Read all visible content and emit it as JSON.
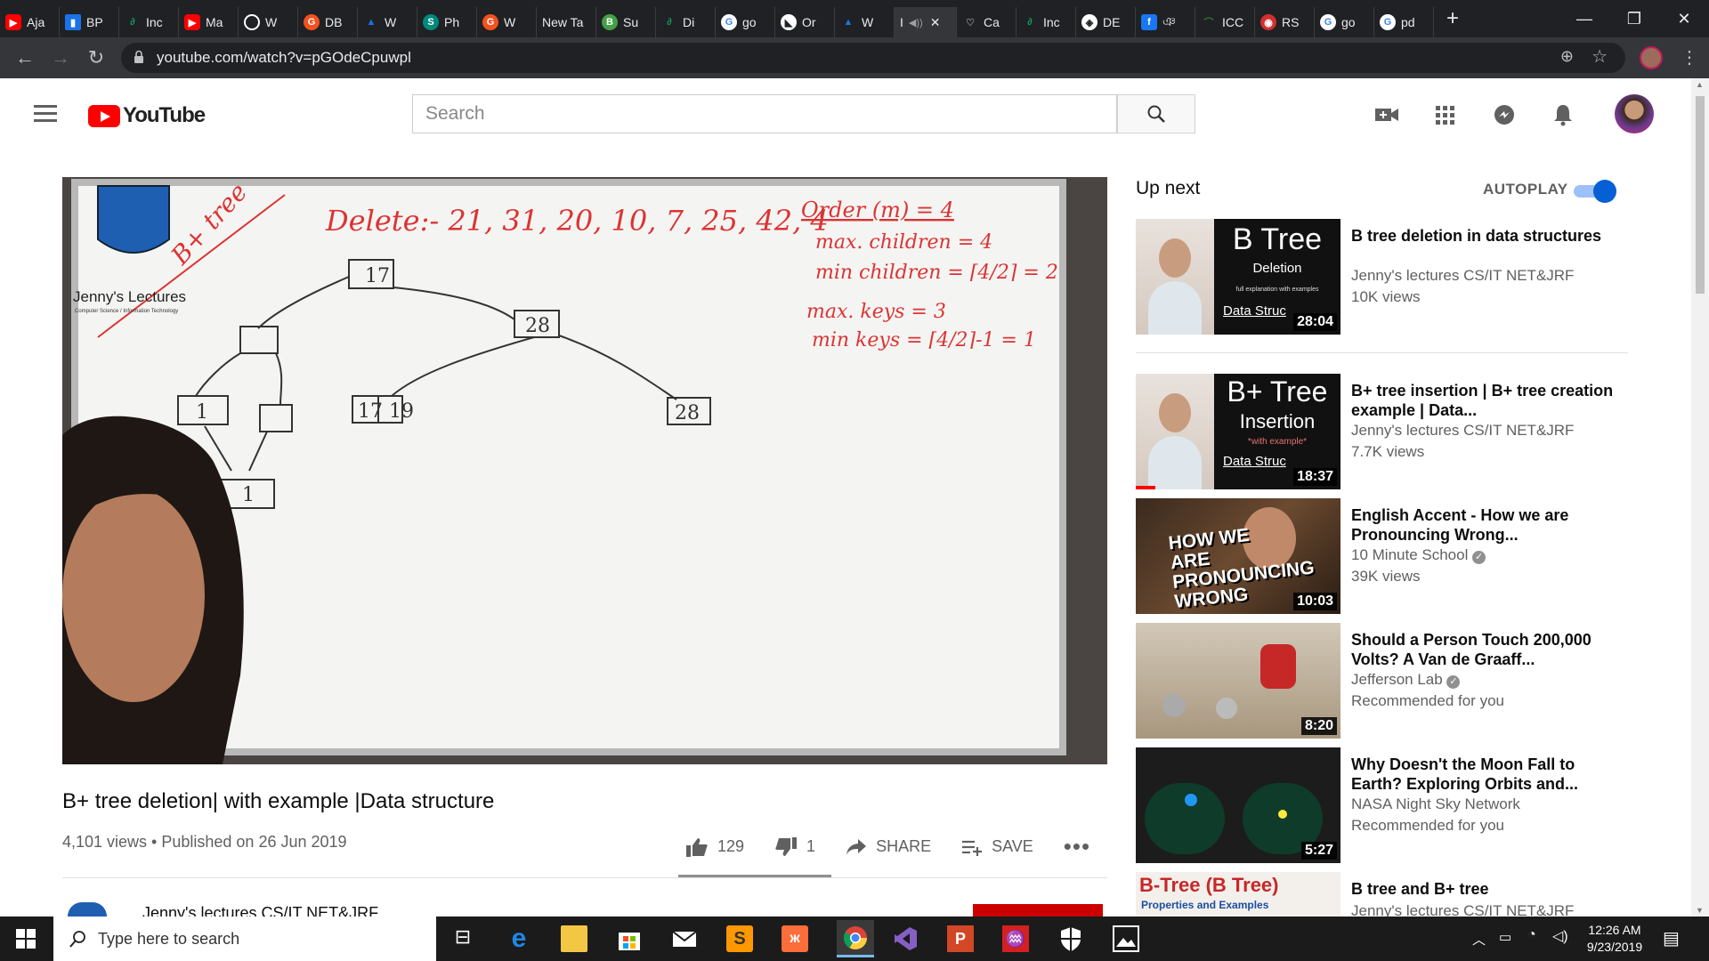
{
  "browser": {
    "tabs": [
      {
        "label": "Aja",
        "color": "#ff0000"
      },
      {
        "label": "BP",
        "color": "#1a73e8"
      },
      {
        "label": "Inc",
        "color": "#0f9d58"
      },
      {
        "label": "Ma",
        "color": "#ff0000"
      },
      {
        "label": "W",
        "color": "#ffffff"
      },
      {
        "label": "DB",
        "color": "#f4511e"
      },
      {
        "label": "W",
        "color": "#1a73e8"
      },
      {
        "label": "Ph",
        "color": "#00897b"
      },
      {
        "label": "W",
        "color": "#f4511e"
      },
      {
        "label": "New Ta",
        "color": ""
      },
      {
        "label": "Su",
        "color": "#43a047"
      },
      {
        "label": "Di",
        "color": "#0f9d58"
      },
      {
        "label": "go",
        "color": "#4285f4"
      },
      {
        "label": "Or",
        "color": "#ffffff"
      },
      {
        "label": "W",
        "color": "#1a73e8"
      },
      {
        "label": "I",
        "color": "",
        "active": true
      },
      {
        "label": "Ca",
        "color": "#888888"
      },
      {
        "label": "Inc",
        "color": "#0f9d58"
      },
      {
        "label": "DE",
        "color": "#ffffff"
      },
      {
        "label": "ঞ",
        "color": "#1877f2"
      },
      {
        "label": "ICC",
        "color": "#2e7d32"
      },
      {
        "label": "RS",
        "color": "#d32f2f"
      },
      {
        "label": "go",
        "color": "#4285f4"
      },
      {
        "label": "pd",
        "color": "#4285f4"
      }
    ],
    "url": "youtube.com/watch?v=pGOdeCpuwpl"
  },
  "youtube": {
    "logo_text": "YouTube",
    "search_placeholder": "Search"
  },
  "video": {
    "title": "B+ tree deletion| with example |Data structure",
    "meta": "4,101 views • Published on 26 Jun 2019",
    "likes": "129",
    "dislikes": "1",
    "share_label": "SHARE",
    "save_label": "SAVE",
    "channel_name": "Jenny's lectures CS/IT NET&JRF",
    "board": {
      "brand": "Jenny's Lectures",
      "brand_sub": "Computer Science / Information Technology",
      "corner_text": "B+ tree",
      "delete_line": "Delete:- 21, 31, 20, 10, 7, 25, 42, 4",
      "order": "Order (m) = 4",
      "max_children": "max. children = 4",
      "min_children": "min children = ⌈4/2⌉ = 2",
      "max_keys": "max. keys = 3",
      "min_keys": "min keys = ⌈4/2⌉-1 = 1",
      "node_root": "17",
      "node_right": "28",
      "node_mid": "17 19",
      "node_leaf_right": "28",
      "node_leaf_left": "1",
      "node_bottom": "1"
    }
  },
  "upnext": {
    "label": "Up next",
    "autoplay_label": "AUTOPLAY",
    "autoplay_on": true,
    "items": [
      {
        "title": "B tree deletion in data structures",
        "channel": "Jenny's lectures CS/IT NET&JRF",
        "views": "10K views",
        "duration": "28:04",
        "thumb_title": "B Tree",
        "thumb_sub": "Deletion",
        "thumb_small": "full explanation with examples",
        "thumb_foot": "Data Struc"
      },
      {
        "title": "B+ tree insertion | B+ tree creation example | Data...",
        "channel": "Jenny's lectures CS/IT NET&JRF",
        "views": "7.7K views",
        "duration": "18:37",
        "thumb_title": "B+ Tree",
        "thumb_sub": "Insertion",
        "thumb_small": "*with example*",
        "thumb_foot": "Data Struc"
      },
      {
        "title": "English Accent - How we are Pronouncing Wrong...",
        "channel": "10 Minute School",
        "views": "39K views",
        "duration": "10:03",
        "thumb_text": "HOW WE ARE PRONOUNCING WRONG",
        "verified": true
      },
      {
        "title": "Should a Person Touch 200,000 Volts? A Van de Graaff...",
        "channel": "Jefferson Lab",
        "views": "Recommended for you",
        "duration": "8:20",
        "verified": true
      },
      {
        "title": "Why Doesn't the Moon Fall to Earth? Exploring Orbits and...",
        "channel": "NASA Night Sky Network",
        "views": "Recommended for you",
        "duration": "5:27"
      },
      {
        "title": "B tree and B+ tree",
        "channel": "Jenny's lectures CS/IT NET&JRF",
        "views": "",
        "duration": "",
        "thumb_title": "B-Tree (B Tree)",
        "thumb_sub": "Properties and Examples"
      }
    ]
  },
  "taskbar": {
    "search_placeholder": "Type here to search",
    "time": "12:26 AM",
    "date": "9/23/2019"
  }
}
